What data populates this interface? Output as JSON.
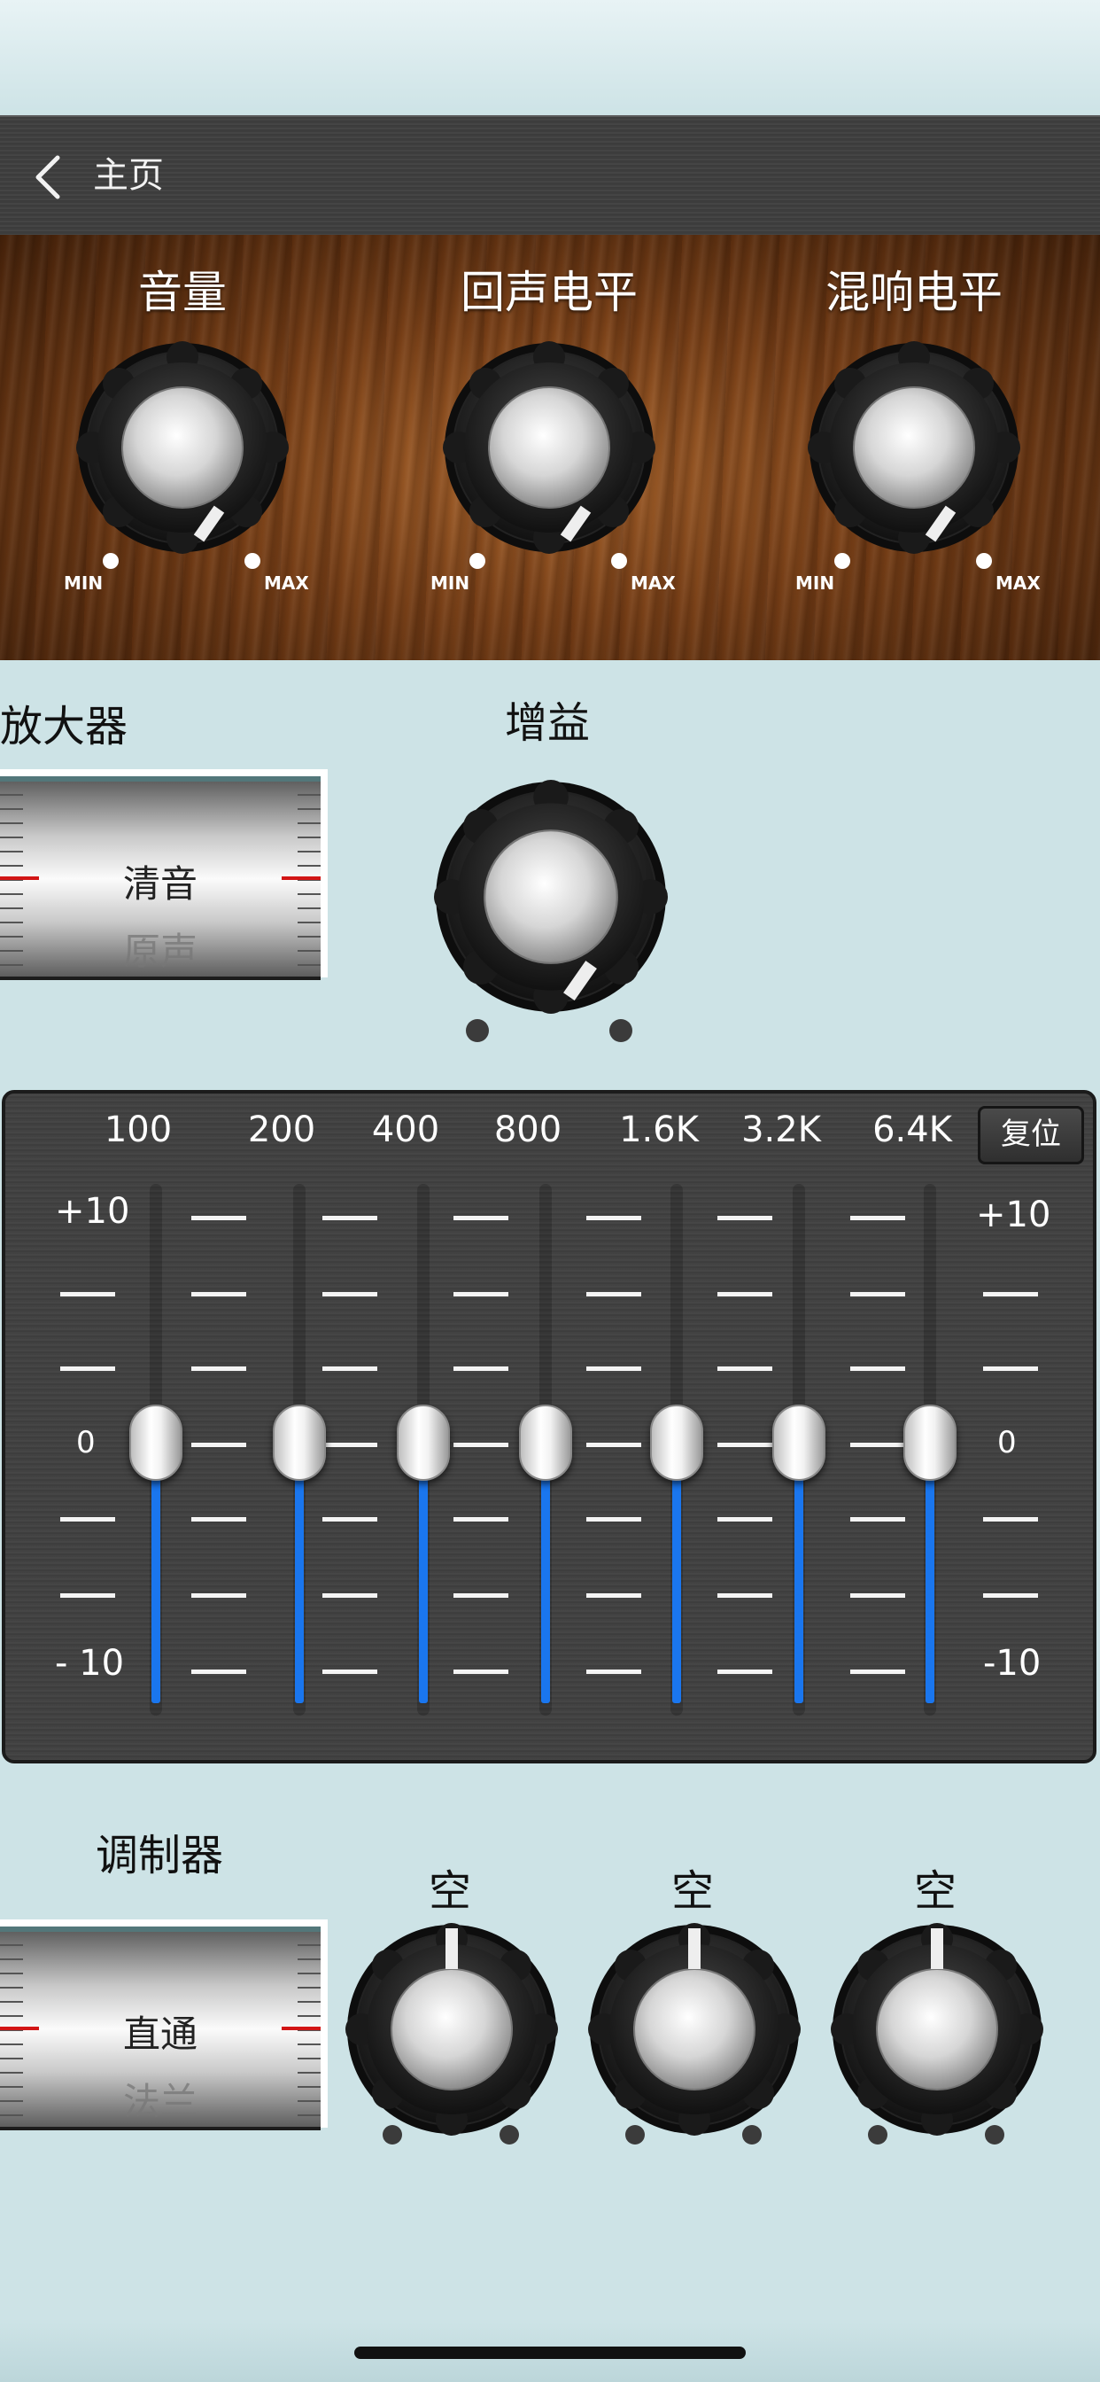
{
  "nav": {
    "back_icon": "chevron-left-icon",
    "title": "主页"
  },
  "top_knobs": [
    {
      "label": "音量",
      "min": "MIN",
      "max": "MAX"
    },
    {
      "label": "回声电平",
      "min": "MIN",
      "max": "MAX"
    },
    {
      "label": "混响电平",
      "min": "MIN",
      "max": "MAX"
    }
  ],
  "amplifier": {
    "label": "放大器",
    "selected": "清音",
    "next": "原声"
  },
  "gain": {
    "label": "增益"
  },
  "eq": {
    "reset_label": "复位",
    "frequencies": [
      "100",
      "200",
      "400",
      "800",
      "1.6K",
      "3.2K",
      "6.4K"
    ],
    "scale_top": "+10",
    "scale_mid": "0",
    "scale_bottom": "- 10",
    "scale_top_right": "+10",
    "scale_mid_right": "0",
    "scale_bottom_right": "-10",
    "band_values": [
      0,
      0,
      0,
      0,
      0,
      0,
      0
    ],
    "range": [
      -10,
      10
    ],
    "fill_color": "#1a76ee"
  },
  "modulator": {
    "label": "调制器",
    "selected": "直通",
    "next": "法兰"
  },
  "mod_knobs": [
    {
      "label": "空"
    },
    {
      "label": "空"
    },
    {
      "label": "空"
    }
  ]
}
